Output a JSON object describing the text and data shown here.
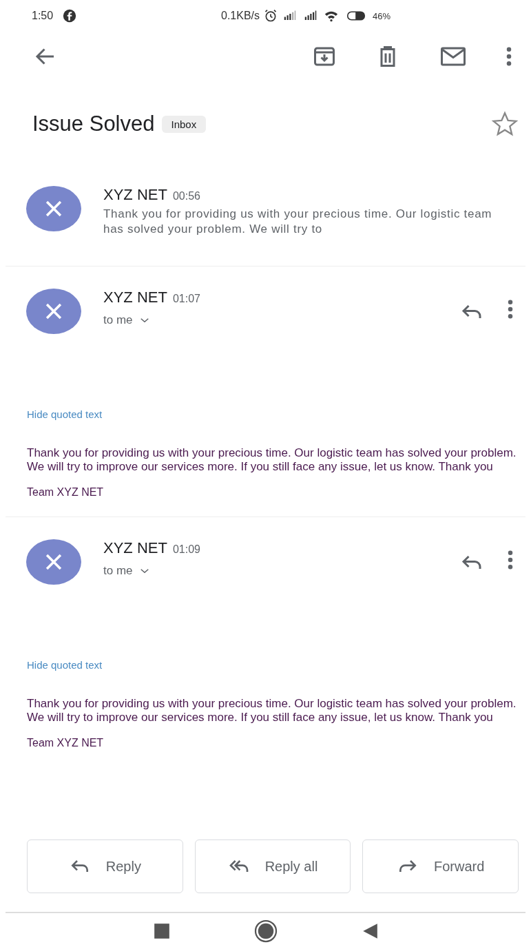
{
  "status_bar": {
    "time": "1:50",
    "speed": "0.1KB/s",
    "battery": "46%"
  },
  "subject": {
    "title": "Issue Solved",
    "label": "Inbox",
    "starred": false
  },
  "messages": [
    {
      "kind": "collapsed",
      "sender": "XYZ NET",
      "time": "00:56",
      "snippet": "Thank you for providing us with your precious time. Our logistic team has solved your problem. We will try to"
    },
    {
      "kind": "expanded",
      "sender": "XYZ NET",
      "time": "01:07",
      "recipient": "to me",
      "quote_toggle": "Hide quoted text",
      "body": "Thank you for providing us with your precious time. Our logistic team has solved your problem. We will try to improve our services more. If you still face any issue, let us know. Thank you",
      "signature": "Team XYZ NET"
    },
    {
      "kind": "expanded",
      "sender": "XYZ NET",
      "time": "01:09",
      "recipient": "to me",
      "quote_toggle": "Hide quoted text",
      "body": "Thank you for providing us with your precious time. Our logistic team has solved your problem. We will try to improve our services more. If you still face any issue, let us know. Thank you",
      "signature": "Team XYZ NET"
    }
  ],
  "actions": [
    {
      "kind": "reply",
      "label": "Reply"
    },
    {
      "kind": "reply_all",
      "label": "Reply all"
    },
    {
      "kind": "forward",
      "label": "Forward"
    }
  ]
}
